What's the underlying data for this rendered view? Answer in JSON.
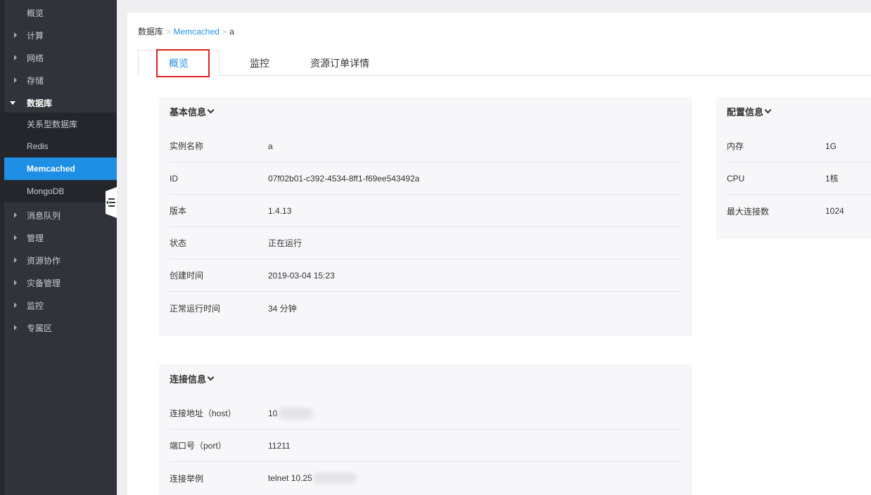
{
  "sidebar": {
    "items": [
      {
        "label": "概览",
        "caret": "none"
      },
      {
        "label": "计算",
        "caret": "right"
      },
      {
        "label": "网络",
        "caret": "right"
      },
      {
        "label": "存储",
        "caret": "right"
      },
      {
        "label": "数据库",
        "caret": "down"
      },
      {
        "label": "消息队列",
        "caret": "right"
      },
      {
        "label": "管理",
        "caret": "right"
      },
      {
        "label": "资源协作",
        "caret": "right"
      },
      {
        "label": "灾备管理",
        "caret": "right"
      },
      {
        "label": "监控",
        "caret": "right"
      },
      {
        "label": "专属区",
        "caret": "right"
      }
    ],
    "database_sub": [
      "关系型数据库",
      "Redis",
      "Memcached",
      "MongoDB"
    ],
    "selected": "Memcached"
  },
  "breadcrumb": {
    "root": "数据库",
    "service": "Memcached",
    "instance": "a"
  },
  "tabs": [
    "概览",
    "监控",
    "资源订单详情"
  ],
  "basic_info": {
    "title": "基本信息",
    "rows": [
      {
        "k": "实例名称",
        "v": "a"
      },
      {
        "k": "ID",
        "v": "07f02b01-c392-4534-8ff1-f69ee543492a"
      },
      {
        "k": "版本",
        "v": "1.4.13"
      },
      {
        "k": "状态",
        "v": "正在运行"
      },
      {
        "k": "创建时间",
        "v": "2019-03-04 15:23"
      },
      {
        "k": "正常运行时间",
        "v": "34 分钟"
      }
    ]
  },
  "config_info": {
    "title": "配置信息",
    "rows": [
      {
        "k": "内存",
        "v": "1G"
      },
      {
        "k": "CPU",
        "v": "1核"
      },
      {
        "k": "最大连接数",
        "v": "1024"
      }
    ]
  },
  "connection_info": {
    "title": "连接信息",
    "rows": [
      {
        "k": "连接地址（host）",
        "v": "10"
      },
      {
        "k": "端口号（port）",
        "v": "11211"
      },
      {
        "k": "连接举例",
        "v": "telnet 10.25"
      }
    ]
  },
  "colors": {
    "accent": "#1f8fe6",
    "sidebar_bg": "#30333a",
    "highlight_box": "#e02020"
  }
}
